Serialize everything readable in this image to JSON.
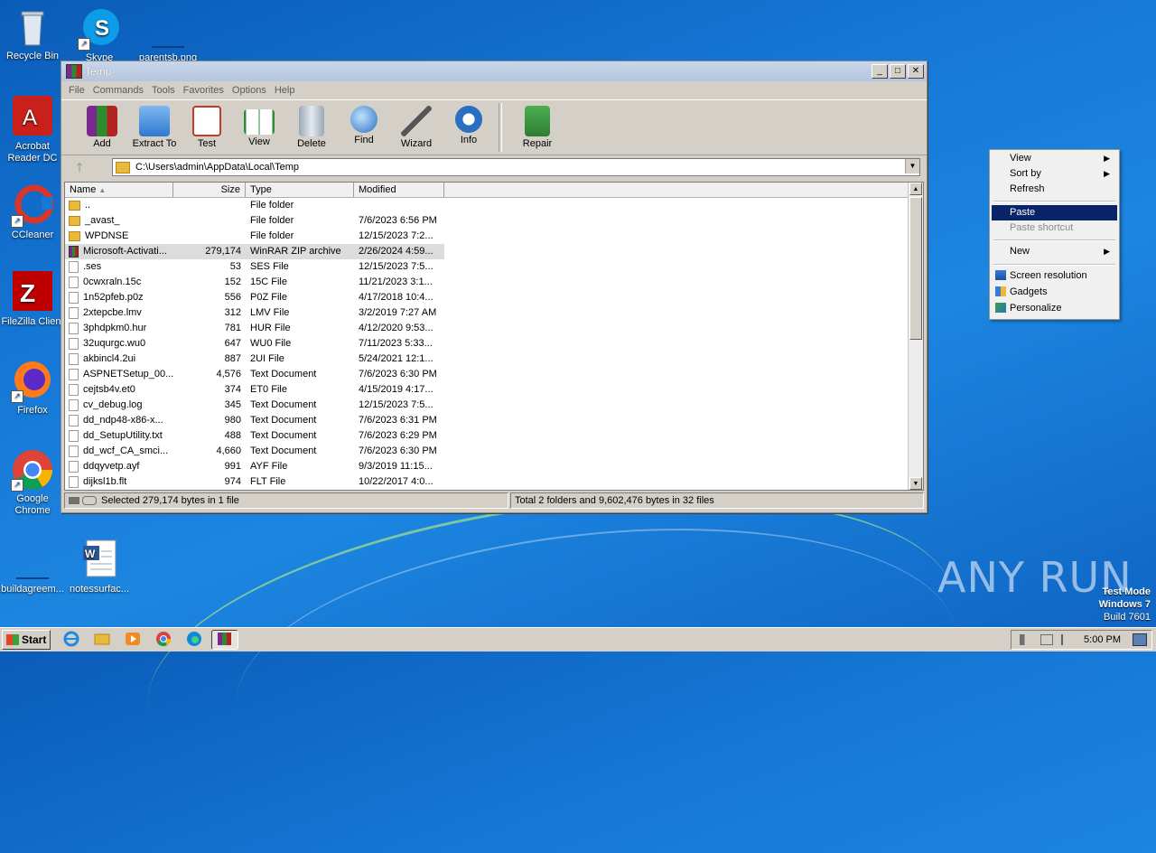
{
  "desktop": {
    "icons": [
      {
        "label": "Recycle Bin"
      },
      {
        "label": "Skype"
      },
      {
        "label": "parentsb.png"
      },
      {
        "label": "Acrobat Reader DC"
      },
      {
        "label": "CCleaner"
      },
      {
        "label": "FileZilla Client"
      },
      {
        "label": "Firefox"
      },
      {
        "label": "Google Chrome"
      },
      {
        "label": "buildagreem..."
      },
      {
        "label": "notessurfac..."
      }
    ]
  },
  "window": {
    "title": "Temp",
    "menu": [
      "File",
      "Commands",
      "Tools",
      "Favorites",
      "Options",
      "Help"
    ],
    "toolbar": [
      "Add",
      "Extract To",
      "Test",
      "View",
      "Delete",
      "Find",
      "Wizard",
      "Info",
      "Repair"
    ],
    "address": "C:\\Users\\admin\\AppData\\Local\\Temp",
    "columns": {
      "name": "Name",
      "size": "Size",
      "type": "Type",
      "modified": "Modified"
    },
    "files": [
      {
        "name": "..",
        "size": "",
        "type": "File folder",
        "modified": "",
        "icon": "folder"
      },
      {
        "name": "_avast_",
        "size": "",
        "type": "File folder",
        "modified": "7/6/2023 6:56 PM",
        "icon": "folder"
      },
      {
        "name": "WPDNSE",
        "size": "",
        "type": "File folder",
        "modified": "12/15/2023 7:2...",
        "icon": "folder"
      },
      {
        "name": "Microsoft-Activati...",
        "size": "279,174",
        "type": "WinRAR ZIP archive",
        "modified": "2/26/2024 4:59...",
        "icon": "rar",
        "selected": true
      },
      {
        "name": ".ses",
        "size": "53",
        "type": "SES File",
        "modified": "12/15/2023 7:5...",
        "icon": "file"
      },
      {
        "name": "0cwxraln.15c",
        "size": "152",
        "type": "15C File",
        "modified": "11/21/2023 3:1...",
        "icon": "file"
      },
      {
        "name": "1n52pfeb.p0z",
        "size": "556",
        "type": "P0Z File",
        "modified": "4/17/2018 10:4...",
        "icon": "file"
      },
      {
        "name": "2xtepcbe.lmv",
        "size": "312",
        "type": "LMV File",
        "modified": "3/2/2019 7:27 AM",
        "icon": "file"
      },
      {
        "name": "3phdpkm0.hur",
        "size": "781",
        "type": "HUR File",
        "modified": "4/12/2020 9:53...",
        "icon": "file"
      },
      {
        "name": "32uqurgc.wu0",
        "size": "647",
        "type": "WU0 File",
        "modified": "7/11/2023 5:33...",
        "icon": "file"
      },
      {
        "name": "akbincl4.2ui",
        "size": "887",
        "type": "2UI File",
        "modified": "5/24/2021 12:1...",
        "icon": "file"
      },
      {
        "name": "ASPNETSetup_00...",
        "size": "4,576",
        "type": "Text Document",
        "modified": "7/6/2023 6:30 PM",
        "icon": "file"
      },
      {
        "name": "cejtsb4v.et0",
        "size": "374",
        "type": "ET0 File",
        "modified": "4/15/2019 4:17...",
        "icon": "file"
      },
      {
        "name": "cv_debug.log",
        "size": "345",
        "type": "Text Document",
        "modified": "12/15/2023 7:5...",
        "icon": "file"
      },
      {
        "name": "dd_ndp48-x86-x...",
        "size": "980",
        "type": "Text Document",
        "modified": "7/6/2023 6:31 PM",
        "icon": "file"
      },
      {
        "name": "dd_SetupUtility.txt",
        "size": "488",
        "type": "Text Document",
        "modified": "7/6/2023 6:29 PM",
        "icon": "file"
      },
      {
        "name": "dd_wcf_CA_smci...",
        "size": "4,660",
        "type": "Text Document",
        "modified": "7/6/2023 6:30 PM",
        "icon": "file"
      },
      {
        "name": "ddqyvetp.ayf",
        "size": "991",
        "type": "AYF File",
        "modified": "9/3/2019 11:15...",
        "icon": "file"
      },
      {
        "name": "dijksl1b.flt",
        "size": "974",
        "type": "FLT File",
        "modified": "10/22/2017 4:0...",
        "icon": "file"
      }
    ],
    "status_left": "Selected 279,174 bytes in 1 file",
    "status_right": "Total 2 folders and 9,602,476 bytes in 32 files"
  },
  "context_menu": {
    "items": [
      {
        "label": "View",
        "submenu": true
      },
      {
        "label": "Sort by",
        "submenu": true
      },
      {
        "label": "Refresh"
      },
      {
        "label": "Paste",
        "highlighted": true
      },
      {
        "label": "Paste shortcut",
        "disabled": true
      },
      {
        "label": "New",
        "submenu": true
      },
      {
        "label": "Screen resolution"
      },
      {
        "label": "Gadgets"
      },
      {
        "label": "Personalize"
      }
    ]
  },
  "watermark": {
    "brand": "ANY RUN",
    "line1": "Test Mode",
    "line2": "Windows 7",
    "line3": "Build 7601"
  },
  "taskbar": {
    "start_label": "Start",
    "clock": "5:00 PM"
  },
  "colors": {
    "desktop": "#1678d6",
    "highlight": "#0a246a",
    "window": "#d4d0c8"
  }
}
